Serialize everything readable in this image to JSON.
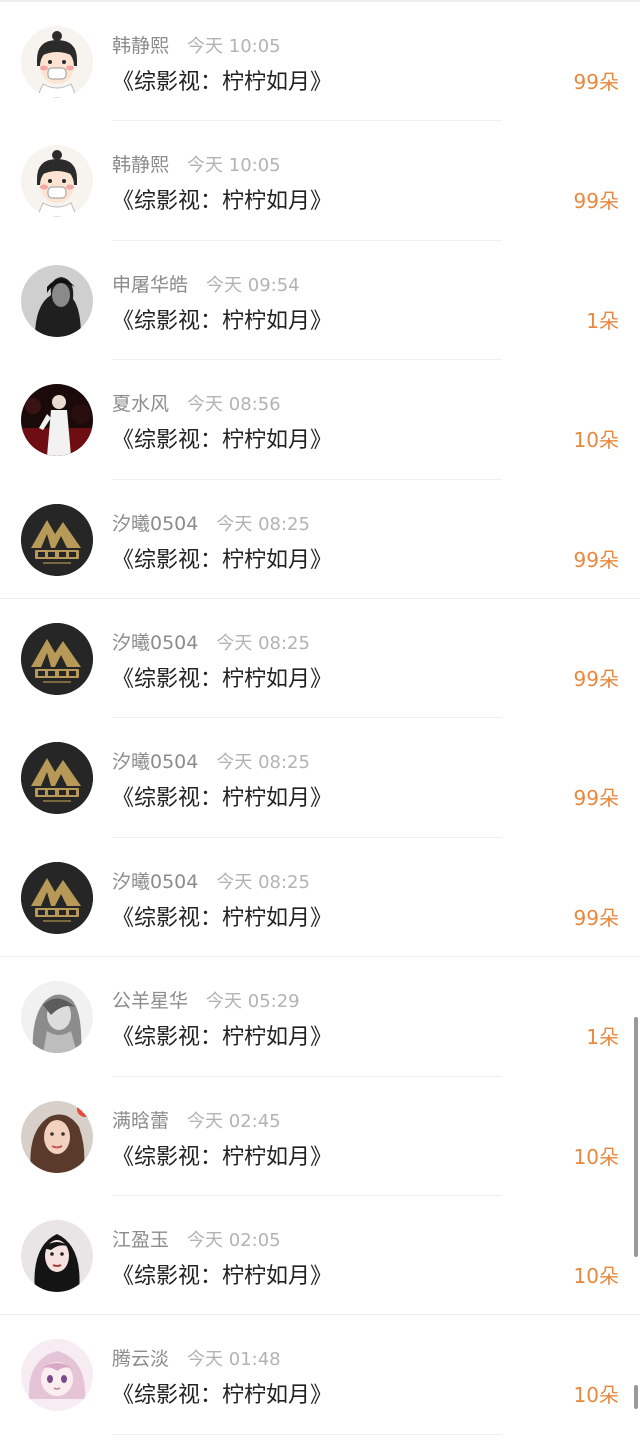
{
  "gifts": [
    {
      "name": "韩静熙",
      "time": "今天 10:05",
      "title": "《综影视：柠柠如月》",
      "amount": "99朵",
      "avatar": "cartoon-girl-mask-avatar",
      "full_divider": false
    },
    {
      "name": "韩静熙",
      "time": "今天 10:05",
      "title": "《综影视：柠柠如月》",
      "amount": "99朵",
      "avatar": "cartoon-girl-mask-avatar",
      "full_divider": false
    },
    {
      "name": "申屠华皓",
      "time": "今天 09:54",
      "title": "《综影视：柠柠如月》",
      "amount": "1朵",
      "avatar": "dark-portrait-avatar",
      "full_divider": false
    },
    {
      "name": "夏水风",
      "time": "今天 08:56",
      "title": "《综影视：柠柠如月》",
      "amount": "10朵",
      "avatar": "stage-performer-avatar",
      "full_divider": false
    },
    {
      "name": "汐曦0504",
      "time": "今天 08:25",
      "title": "《综影视：柠柠如月》",
      "amount": "99朵",
      "avatar": "gold-mountain-logo-avatar",
      "full_divider": true
    },
    {
      "name": "汐曦0504",
      "time": "今天 08:25",
      "title": "《综影视：柠柠如月》",
      "amount": "99朵",
      "avatar": "gold-mountain-logo-avatar",
      "full_divider": false
    },
    {
      "name": "汐曦0504",
      "time": "今天 08:25",
      "title": "《综影视：柠柠如月》",
      "amount": "99朵",
      "avatar": "gold-mountain-logo-avatar",
      "full_divider": false
    },
    {
      "name": "汐曦0504",
      "time": "今天 08:25",
      "title": "《综影视：柠柠如月》",
      "amount": "99朵",
      "avatar": "gold-mountain-logo-avatar",
      "full_divider": true
    },
    {
      "name": "公羊星华",
      "time": "今天 05:29",
      "title": "《综影视：柠柠如月》",
      "amount": "1朵",
      "avatar": "grayscale-woman-avatar",
      "full_divider": false
    },
    {
      "name": "满晗蕾",
      "time": "今天 02:45",
      "title": "《综影视：柠柠如月》",
      "amount": "10朵",
      "avatar": "woman-selfie-avatar",
      "full_divider": false
    },
    {
      "name": "江盈玉",
      "time": "今天 02:05",
      "title": "《综影视：柠柠如月》",
      "amount": "10朵",
      "avatar": "dark-hair-woman-avatar",
      "full_divider": true
    },
    {
      "name": "腾云淡",
      "time": "今天 01:48",
      "title": "《综影视：柠柠如月》",
      "amount": "10朵",
      "avatar": "anime-girl-avatar",
      "full_divider": false
    }
  ],
  "colors": {
    "amount": "#e8883f",
    "name": "#8c8c8c",
    "time": "#b3b3b3",
    "title": "#222222"
  }
}
